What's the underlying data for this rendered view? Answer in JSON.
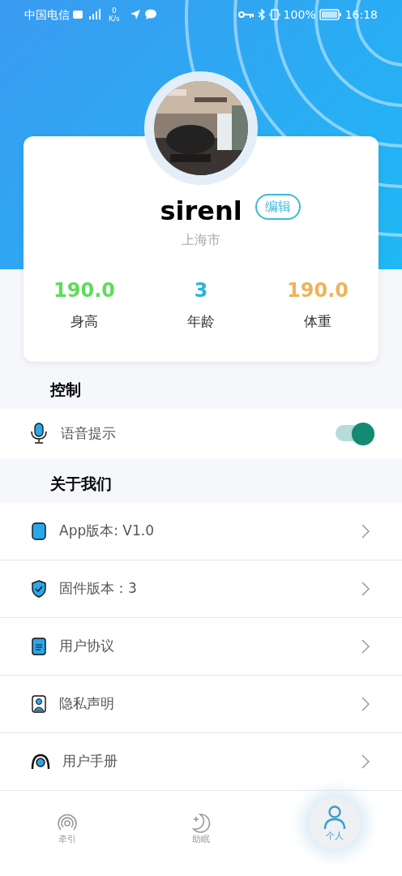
{
  "status_bar": {
    "carrier": "中国电信",
    "speed_value": "0",
    "speed_unit": "K/s",
    "battery": "100%",
    "time": "16:18"
  },
  "profile": {
    "name": "sirenl",
    "edit_button": "编辑",
    "city": "上海市",
    "stats": [
      {
        "value": "190.0",
        "label": "身高",
        "color": "#5ddc5a"
      },
      {
        "value": "3",
        "label": "年龄",
        "color": "#2bb3e0"
      },
      {
        "value": "190.0",
        "label": "体重",
        "color": "#ecb45c"
      }
    ]
  },
  "control_section": {
    "title": "控制",
    "items": [
      {
        "label": "语音提示",
        "on": true
      }
    ]
  },
  "about_section": {
    "title": "关于我们",
    "items": [
      {
        "kind": "phone",
        "label": "App版本: V1.0"
      },
      {
        "kind": "shield",
        "label": "固件版本：3"
      },
      {
        "kind": "document",
        "label": "用户协议"
      },
      {
        "kind": "person",
        "label": "隐私声明"
      },
      {
        "kind": "camera",
        "label": "用户手册"
      }
    ]
  },
  "tab_bar": [
    {
      "kind": "rings",
      "label": "牵引",
      "selected": false
    },
    {
      "kind": "moon",
      "label": "助眠",
      "selected": false
    },
    {
      "kind": "person",
      "label": "个人",
      "selected": true
    }
  ]
}
